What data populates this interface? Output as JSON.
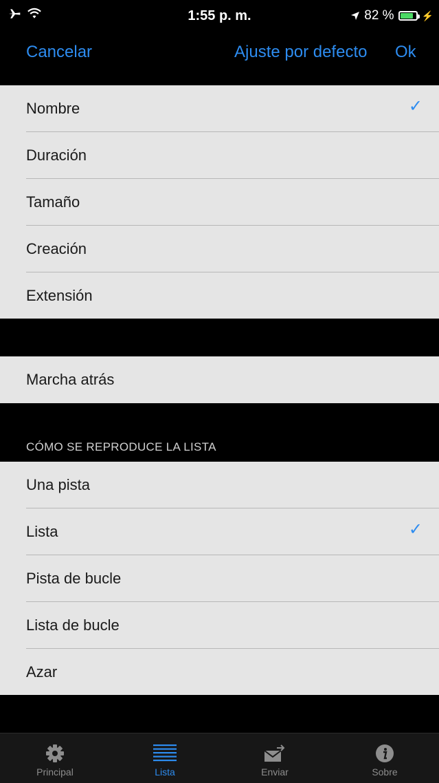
{
  "status": {
    "time": "1:55 p. m.",
    "battery": "82 %",
    "battery_level": 0.82
  },
  "nav": {
    "cancel": "Cancelar",
    "default": "Ajuste por defecto",
    "ok": "Ok"
  },
  "sort_section": {
    "items": [
      {
        "label": "Nombre",
        "checked": true
      },
      {
        "label": "Duración",
        "checked": false
      },
      {
        "label": "Tamaño",
        "checked": false
      },
      {
        "label": "Creación",
        "checked": false
      },
      {
        "label": "Extensión",
        "checked": false
      }
    ]
  },
  "reverse_section": {
    "label": "Marcha atrás"
  },
  "play_section": {
    "header": "CÓMO SE REPRODUCE LA LISTA",
    "items": [
      {
        "label": "Una pista",
        "checked": false
      },
      {
        "label": "Lista",
        "checked": true
      },
      {
        "label": "Pista de bucle",
        "checked": false
      },
      {
        "label": "Lista de bucle",
        "checked": false
      },
      {
        "label": "Azar",
        "checked": false
      }
    ]
  },
  "tabbar": {
    "active": 1,
    "tabs": [
      {
        "label": "Principal",
        "icon": "gear-icon"
      },
      {
        "label": "Lista",
        "icon": "list-icon"
      },
      {
        "label": "Enviar",
        "icon": "send-icon"
      },
      {
        "label": "Sobre",
        "icon": "info-icon"
      }
    ]
  },
  "colors": {
    "accent": "#2d8cf0",
    "row_bg": "#e5e5e5",
    "background": "#000000"
  }
}
